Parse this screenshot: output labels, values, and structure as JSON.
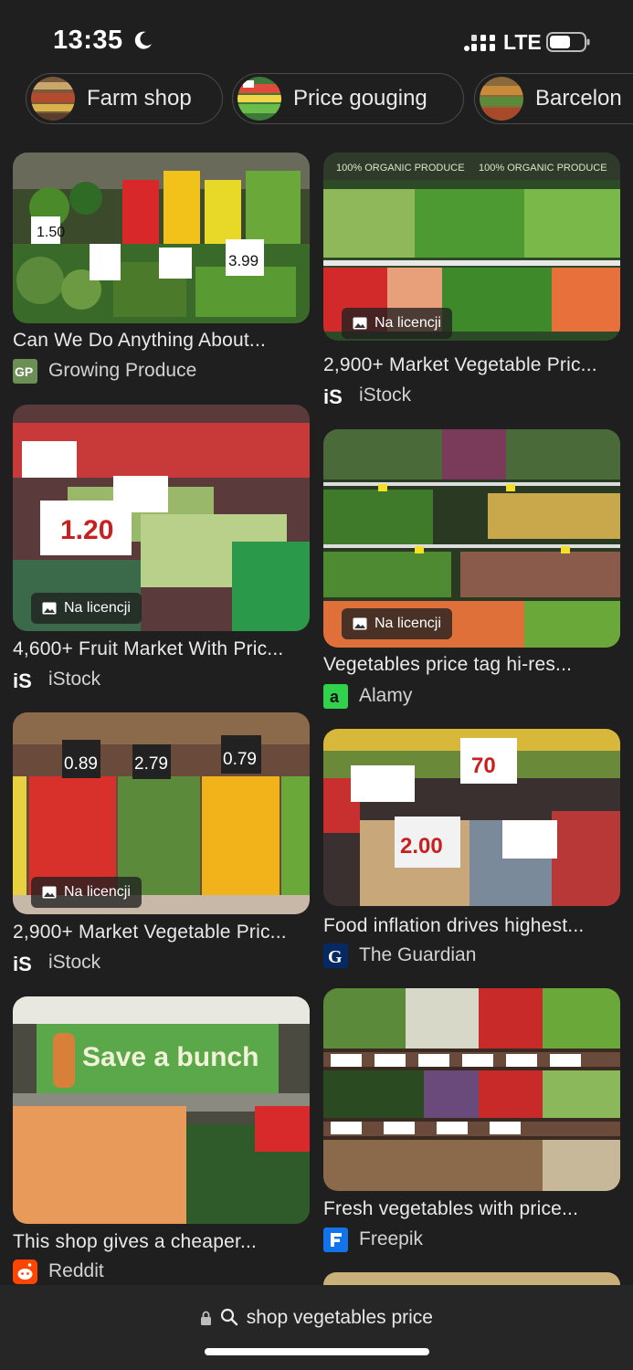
{
  "status_bar": {
    "time": "13:35",
    "network": "LTE"
  },
  "chips": [
    {
      "label": "Farm shop"
    },
    {
      "label": "Price gouging"
    },
    {
      "label": "Barcelon"
    }
  ],
  "results": [
    {
      "title": "Can We Do Anything About...",
      "source": "Growing Produce",
      "logo_text": "GP",
      "badge": ""
    },
    {
      "title": "2,900+ Market Vegetable Pric...",
      "source": "iStock",
      "logo_text": "iS",
      "badge": "Na licencji"
    },
    {
      "title": "4,600+ Fruit Market With Pric...",
      "source": "iStock",
      "logo_text": "iS",
      "badge": "Na licencji"
    },
    {
      "title": "Vegetables price tag hi-res...",
      "source": "Alamy",
      "logo_text": "a",
      "badge": "Na licencji"
    },
    {
      "title": "2,900+ Market Vegetable Pric...",
      "source": "iStock",
      "logo_text": "iS",
      "badge": "Na licencji"
    },
    {
      "title": "Food inflation drives highest...",
      "source": "The Guardian",
      "logo_text": "G",
      "badge": ""
    },
    {
      "title": "This shop gives a cheaper...",
      "source": "Reddit",
      "logo_text": "",
      "badge": ""
    },
    {
      "title": "Fresh vegetables with price...",
      "source": "Freepik",
      "logo_text": "F",
      "badge": ""
    }
  ],
  "image_text": {
    "tag_150": "1.50",
    "tag_399": "3.99",
    "tag_120": "1.20",
    "tag_089": "0.89",
    "tag_279": "2.79",
    "tag_079": "0.79",
    "tag_070": "70",
    "tag_200": "2.00",
    "banner_organic": "100% ORGANIC PRODUCE",
    "banner_save": "Save a bunch"
  },
  "address_bar": {
    "text": "shop vegetables price"
  },
  "colors": {
    "background": "#1f1f1f",
    "chip_border": "#4b4b4b",
    "alamy_green": "#2fd24a",
    "reddit_orange": "#ff4500",
    "freepik_blue": "#1273eb",
    "guardian_blue": "#052962"
  }
}
